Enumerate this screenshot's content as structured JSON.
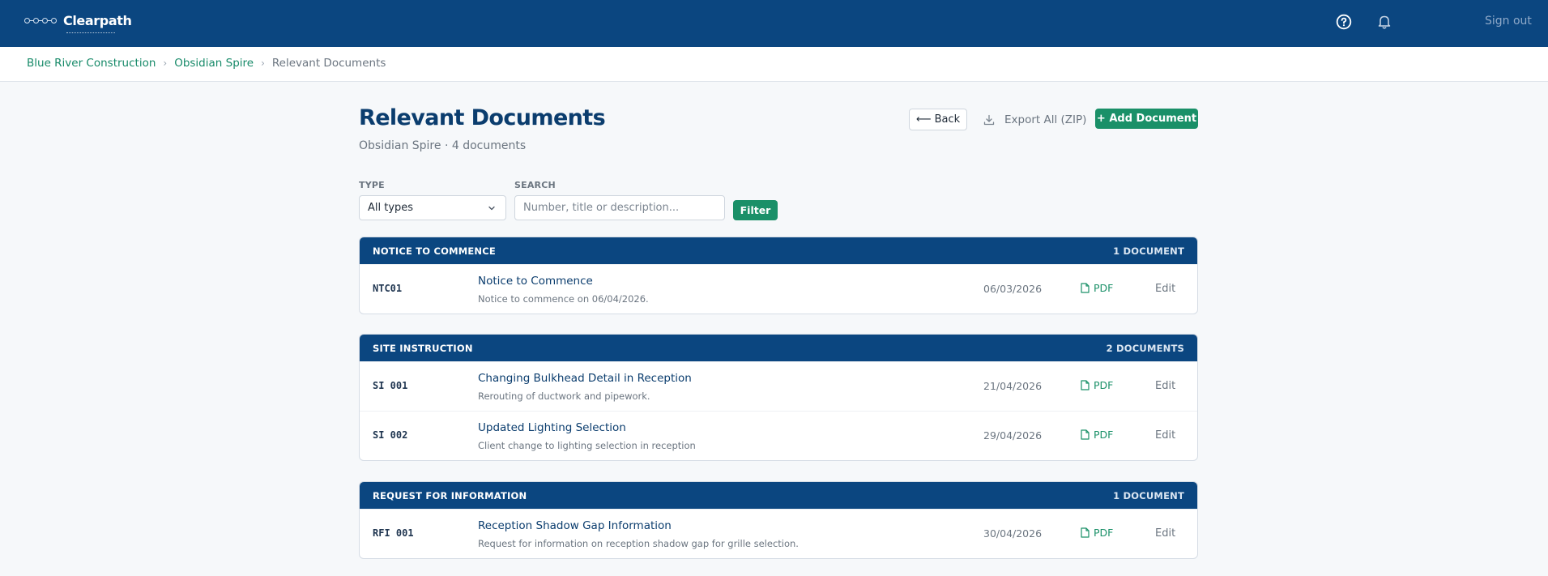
{
  "app": {
    "name": "Clearpath",
    "sign_out": "Sign out",
    "help_icon": "help-circle-icon",
    "bell_icon": "bell-icon"
  },
  "breadcrumb": {
    "items": [
      "Blue River Construction",
      "Obsidian Spire"
    ],
    "current": "Relevant Documents"
  },
  "header": {
    "title": "Relevant Documents",
    "subtitle": "Obsidian Spire · 4 documents",
    "back_label": "⟵ Back",
    "export_label": "Export All (ZIP)",
    "add_label": "+ Add Document"
  },
  "filters": {
    "type_label": "TYPE",
    "type_value": "All types",
    "search_label": "SEARCH",
    "search_placeholder": "Number, title or description...",
    "search_value": "",
    "filter_label": "Filter"
  },
  "labels": {
    "pdf": "PDF",
    "edit": "Edit"
  },
  "sections": [
    {
      "name": "NOTICE TO COMMENCE",
      "count": "1 DOCUMENT",
      "docs": [
        {
          "number": "NTC01",
          "title": "Notice to Commence",
          "description": "Notice to commence on 06/04/2026.",
          "date": "06/03/2026"
        }
      ]
    },
    {
      "name": "SITE INSTRUCTION",
      "count": "2 DOCUMENTS",
      "docs": [
        {
          "number": "SI 001",
          "title": "Changing Bulkhead Detail in Reception",
          "description": "Rerouting of ductwork and pipework.",
          "date": "21/04/2026"
        },
        {
          "number": "SI 002",
          "title": "Updated Lighting Selection",
          "description": "Client change to lighting selection in reception",
          "date": "29/04/2026"
        }
      ]
    },
    {
      "name": "REQUEST FOR INFORMATION",
      "count": "1 DOCUMENT",
      "docs": [
        {
          "number": "RFI 001",
          "title": "Reception Shadow Gap Information",
          "description": "Request for information on reception shadow gap for grille selection.",
          "date": "30/04/2026"
        }
      ]
    }
  ],
  "colors": {
    "primary": "#0b4680",
    "accent": "#1a9068",
    "title": "#0b3d6e"
  }
}
